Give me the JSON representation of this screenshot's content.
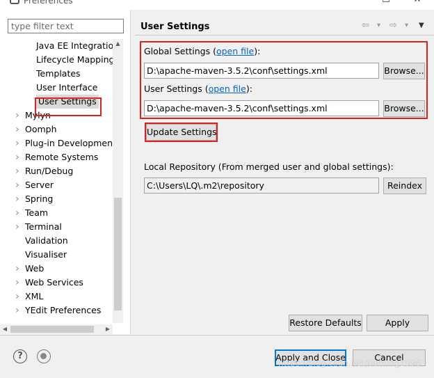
{
  "window": {
    "title": "Preferences",
    "controls": {
      "minimize": "—",
      "maximize": "☐",
      "close": "✕"
    }
  },
  "left": {
    "filter_placeholder": "type filter text",
    "tree": [
      {
        "label": "Java EE Integratio",
        "level": 2,
        "expandable": false
      },
      {
        "label": "Lifecycle Mapping",
        "level": 2,
        "expandable": false
      },
      {
        "label": "Templates",
        "level": 2,
        "expandable": false
      },
      {
        "label": "User Interface",
        "level": 2,
        "expandable": false
      },
      {
        "label": "User Settings",
        "level": 2,
        "expandable": false,
        "selected": true
      },
      {
        "label": "Mylyn",
        "level": 1,
        "expandable": true
      },
      {
        "label": "Oomph",
        "level": 1,
        "expandable": true
      },
      {
        "label": "Plug-in Development",
        "level": 1,
        "expandable": true
      },
      {
        "label": "Remote Systems",
        "level": 1,
        "expandable": true
      },
      {
        "label": "Run/Debug",
        "level": 1,
        "expandable": true
      },
      {
        "label": "Server",
        "level": 1,
        "expandable": true
      },
      {
        "label": "Spring",
        "level": 1,
        "expandable": true
      },
      {
        "label": "Team",
        "level": 1,
        "expandable": true
      },
      {
        "label": "Terminal",
        "level": 1,
        "expandable": true
      },
      {
        "label": "Validation",
        "level": 1,
        "expandable": false
      },
      {
        "label": "Visualiser",
        "level": 1,
        "expandable": false
      },
      {
        "label": "Web",
        "level": 1,
        "expandable": true
      },
      {
        "label": "Web Services",
        "level": 1,
        "expandable": true
      },
      {
        "label": "XML",
        "level": 1,
        "expandable": true
      },
      {
        "label": "YEdit Preferences",
        "level": 1,
        "expandable": true
      }
    ]
  },
  "right": {
    "page_title": "User Settings",
    "nav": {
      "back": "⇦",
      "back_menu": "▾",
      "forward": "⇨",
      "forward_menu": "▾",
      "view_menu": "▼"
    },
    "global": {
      "label_prefix": "Global Settings (",
      "label_link": "open file",
      "label_suffix": "):",
      "value": "D:\\apache-maven-3.5.2\\conf\\settings.xml",
      "browse": "Browse..."
    },
    "user": {
      "label_prefix": "User Settings (",
      "label_link": "open file",
      "label_suffix": "):",
      "value": "D:\\apache-maven-3.5.2\\conf\\settings.xml",
      "browse": "Browse..."
    },
    "update_button": "Update Settings",
    "local_repo_label": "Local Repository (From merged user and global settings):",
    "local_repo_value": "C:\\Users\\LQ\\.m2\\repository",
    "reindex": "Reindex",
    "restore_defaults": "Restore Defaults",
    "apply": "Apply"
  },
  "footer": {
    "apply_close": "Apply and Close",
    "cancel": "Cancel"
  },
  "watermark": "https://blog.csdn.net/burning1996",
  "colors": {
    "highlight": "#e02020",
    "link": "#0066cc",
    "default_button": "#0078d7"
  }
}
